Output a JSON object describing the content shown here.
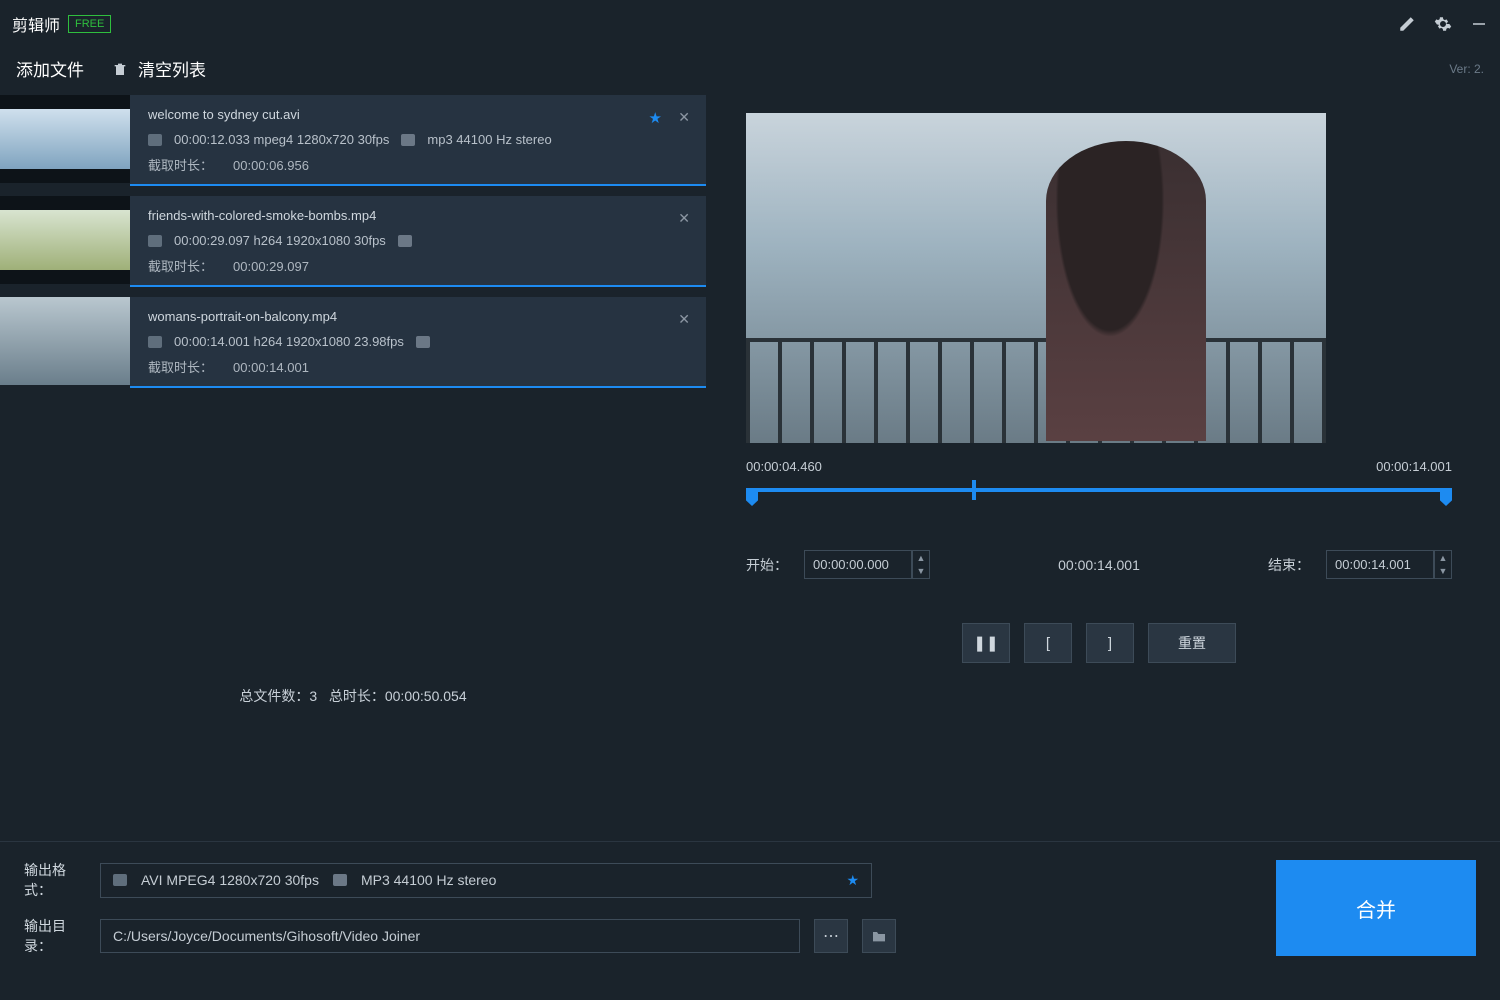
{
  "app": {
    "name": "剪辑师",
    "badge": "FREE",
    "version": "Ver: 2."
  },
  "toolbar": {
    "add": "添加文件",
    "clear": "清空列表"
  },
  "files": [
    {
      "name": "welcome to sydney cut.avi",
      "video_meta": "00:00:12.033 mpeg4 1280x720 30fps",
      "audio_meta": "mp3 44100 Hz stereo",
      "cut_label": "截取时长：",
      "cut_value": "00:00:06.956",
      "starred": true
    },
    {
      "name": "friends-with-colored-smoke-bombs.mp4",
      "video_meta": "00:00:29.097 h264 1920x1080 30fps",
      "audio_meta": "",
      "cut_label": "截取时长：",
      "cut_value": "00:00:29.097",
      "starred": false
    },
    {
      "name": "womans-portrait-on-balcony.mp4",
      "video_meta": "00:00:14.001 h264 1920x1080 23.98fps",
      "audio_meta": "",
      "cut_label": "截取时长：",
      "cut_value": "00:00:14.001",
      "starred": false
    }
  ],
  "totals": {
    "count_label": "总文件数：",
    "count_value": "3",
    "dur_label": "总时长：",
    "dur_value": "00:00:50.054"
  },
  "preview": {
    "pos": "00:00:04.460",
    "end": "00:00:14.001",
    "start_label": "开始：",
    "start_value": "00:00:00.000",
    "mid_value": "00:00:14.001",
    "end_label": "结束：",
    "end_value": "00:00:14.001",
    "reset": "重置"
  },
  "output": {
    "format_label": "输出格式：",
    "video_fmt": "AVI MPEG4 1280x720 30fps",
    "audio_fmt": "MP3 44100 Hz stereo",
    "dir_label": "输出目录：",
    "dir_value": "C:/Users/Joyce/Documents/Gihosoft/Video Joiner"
  },
  "merge": "合并"
}
